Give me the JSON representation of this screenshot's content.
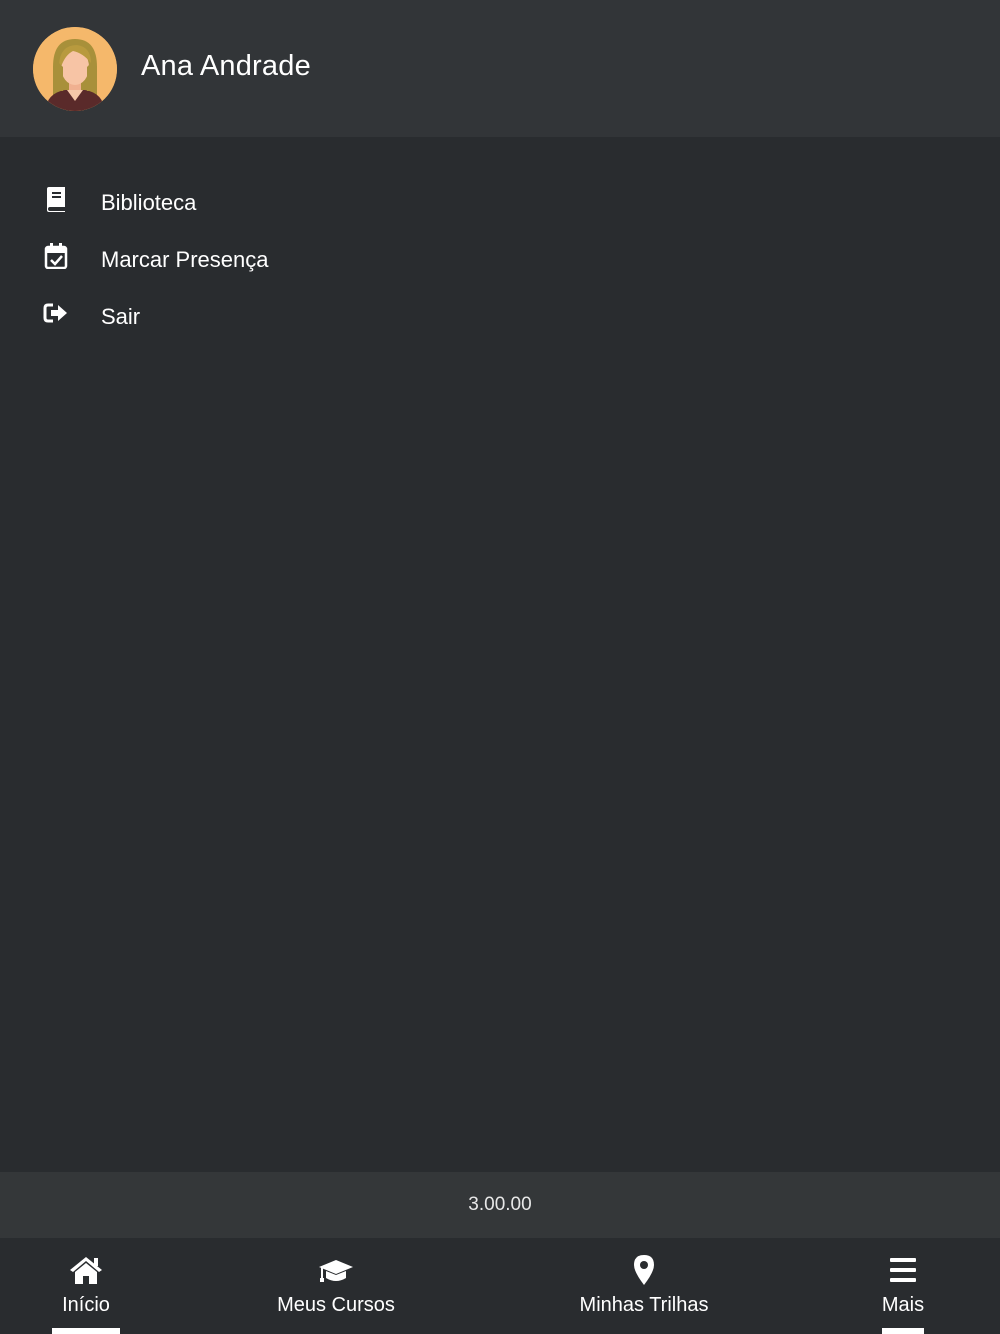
{
  "profile": {
    "name": "Ana Andrade",
    "avatar_icon": "female-user-avatar"
  },
  "menu": [
    {
      "label": "Biblioteca",
      "icon": "book-icon"
    },
    {
      "label": "Marcar Presença",
      "icon": "calendar-check-icon"
    },
    {
      "label": "Sair",
      "icon": "sign-out-icon"
    }
  ],
  "version": "3.00.00",
  "bottom_nav": [
    {
      "label": "Início",
      "icon": "home-icon",
      "underline": true
    },
    {
      "label": "Meus Cursos",
      "icon": "graduation-cap-icon",
      "underline": false
    },
    {
      "label": "Minhas Trilhas",
      "icon": "map-pin-icon",
      "underline": false
    },
    {
      "label": "Mais",
      "icon": "menu-bars-icon",
      "underline": true
    }
  ],
  "colors": {
    "background": "#292c2f",
    "header": "#323538",
    "text": "#ffffff",
    "avatar_bg": "#f5b86b"
  }
}
